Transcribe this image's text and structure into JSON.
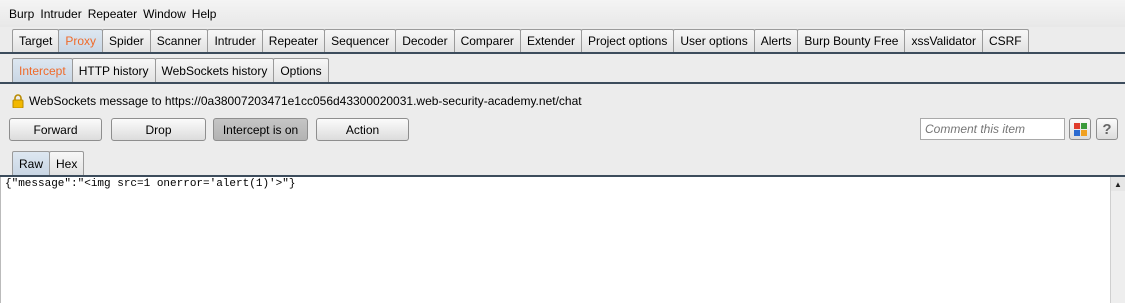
{
  "menu": [
    "Burp",
    "Intruder",
    "Repeater",
    "Window",
    "Help"
  ],
  "main_tabs": [
    "Target",
    "Proxy",
    "Spider",
    "Scanner",
    "Intruder",
    "Repeater",
    "Sequencer",
    "Decoder",
    "Comparer",
    "Extender",
    "Project options",
    "User options",
    "Alerts",
    "Burp Bounty Free",
    "xssValidator",
    "CSRF"
  ],
  "main_tab_active": "Proxy",
  "sub_tabs": [
    "Intercept",
    "HTTP history",
    "WebSockets history",
    "Options"
  ],
  "sub_tab_active": "Intercept",
  "ws_message": "WebSockets message to https://0a38007203471e1cc056d43300020031.web-security-academy.net/chat",
  "buttons": {
    "forward": "Forward",
    "drop": "Drop",
    "intercept": "Intercept is on",
    "action": "Action"
  },
  "comment_placeholder": "Comment this item",
  "help_label": "?",
  "editor_tabs": [
    "Raw",
    "Hex"
  ],
  "editor_tab_active": "Raw",
  "editor_content": "{\"message\":\"<img src=1 onerror='alert(1)'>\"}",
  "colors": {
    "accent": "#ef6a2a",
    "grid_icon": [
      "#e03c2c",
      "#3a9a3a",
      "#2a6ad0",
      "#f0a020"
    ]
  }
}
